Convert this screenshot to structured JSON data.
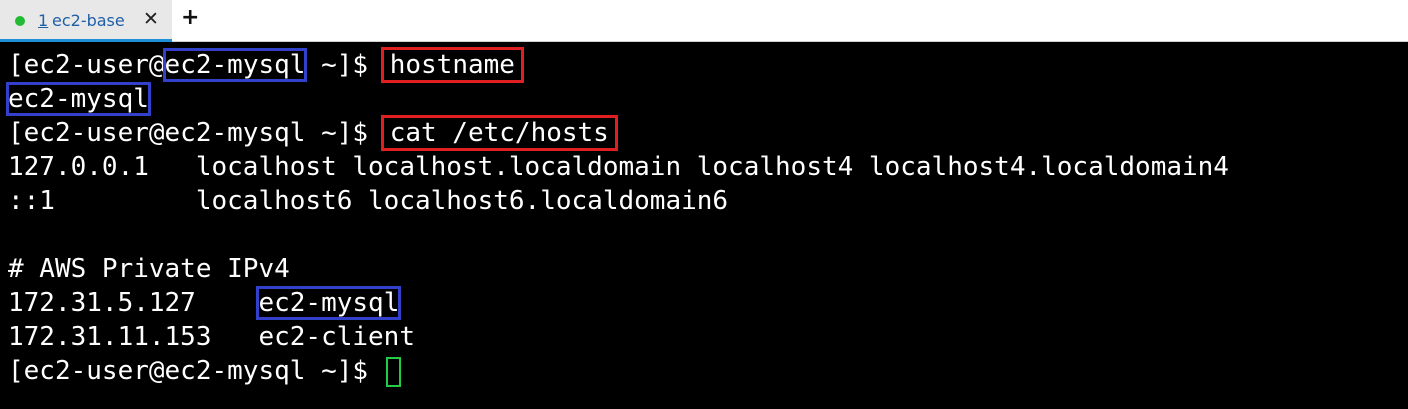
{
  "tabbar": {
    "tab": {
      "number": "1",
      "label": "ec2-base",
      "close_glyph": "✕",
      "status_color": "#22bb33"
    },
    "new_tab_glyph": "+"
  },
  "terminal": {
    "prompt_user": "[ec2-user@",
    "prompt_host": "ec2-mysql",
    "prompt_suffix": " ~]$ ",
    "cmd1": "hostname",
    "out_hostname": "ec2-mysql",
    "prompt_full": "[ec2-user@ec2-mysql ~]$ ",
    "cmd2": "cat /etc/hosts",
    "hosts_line1": "127.0.0.1   localhost localhost.localdomain localhost4 localhost4.localdomain4",
    "hosts_line2": "::1         localhost6 localhost6.localdomain6",
    "hosts_comment": "# AWS Private IPv4",
    "hosts_ip3": "172.31.5.127",
    "hosts_gap3": "    ",
    "hosts_name3": "ec2-mysql",
    "hosts_line4": "172.31.11.153   ec2-client",
    "final_prompt": "[ec2-user@ec2-mysql ~]$ ",
    "highlight_blue": "#3340cc",
    "highlight_red": "#e02020",
    "cursor_color": "#22cc44"
  }
}
